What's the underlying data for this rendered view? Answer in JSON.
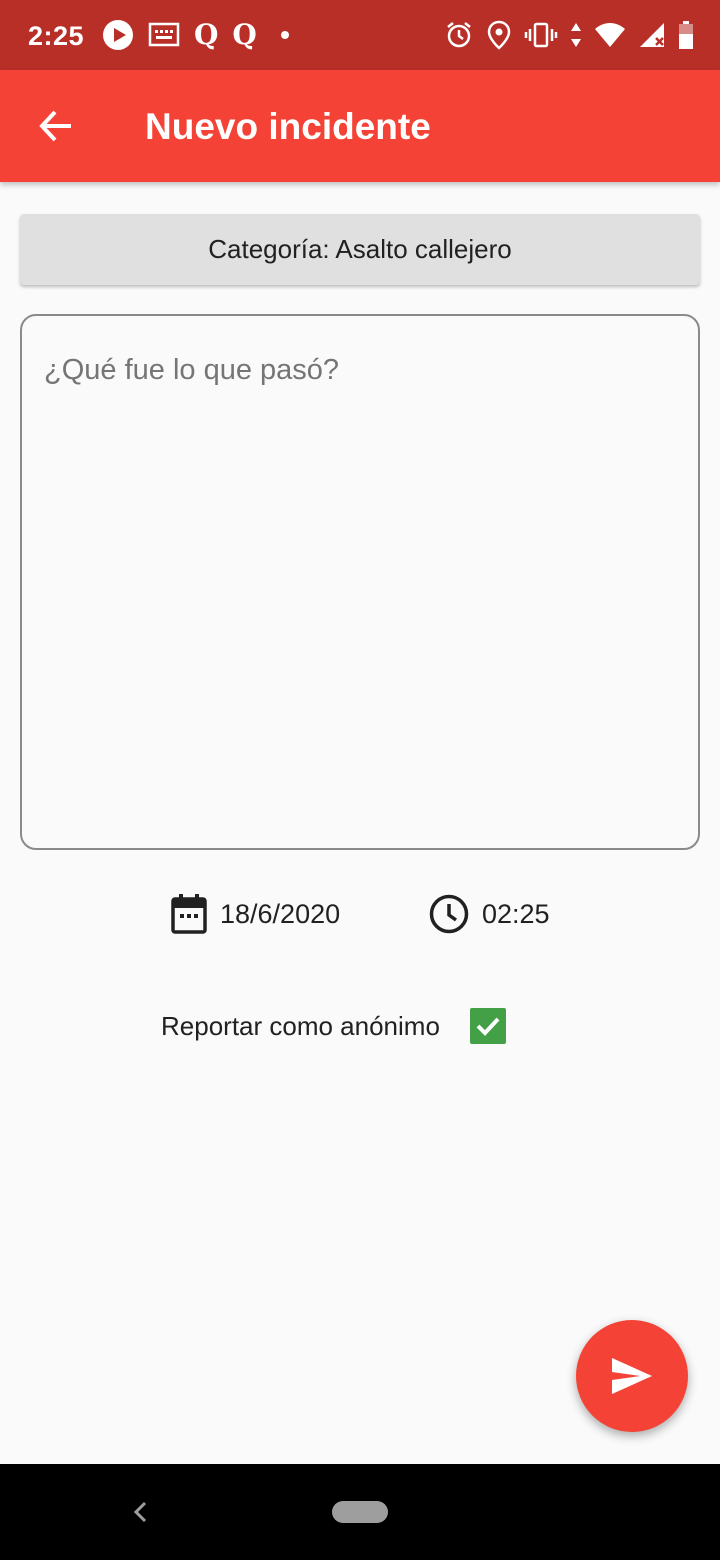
{
  "status_bar": {
    "time": "2:25",
    "left_icons": [
      "play-icon",
      "keyboard-notification-icon",
      "q-app-icon",
      "q-app-icon",
      "more-notifications-dot-icon"
    ],
    "right_icons": [
      "alarm-icon",
      "location-icon",
      "vibrate-icon",
      "data-arrows-icon",
      "wifi-icon",
      "cellular-signal-icon",
      "battery-icon"
    ],
    "q_label": "Q"
  },
  "app_bar": {
    "title": "Nuevo incidente",
    "back_icon": "arrow-back-icon"
  },
  "form": {
    "category_label": "Categoría: Asalto callejero",
    "description_placeholder": "¿Qué fue lo que pasó?",
    "description_value": "",
    "date": "18/6/2020",
    "time": "02:25",
    "anonymous_label": "Reportar como anónimo",
    "anonymous_checked": true
  },
  "fab": {
    "icon": "send-icon"
  },
  "nav_bar": {
    "back_icon": "nav-back-icon",
    "home_icon": "nav-home-pill-icon"
  },
  "colors": {
    "status_bar": "#b82f28",
    "app_bar": "#f44336",
    "accent": "#f44336",
    "checkbox": "#43a047",
    "background": "#fafafa"
  }
}
